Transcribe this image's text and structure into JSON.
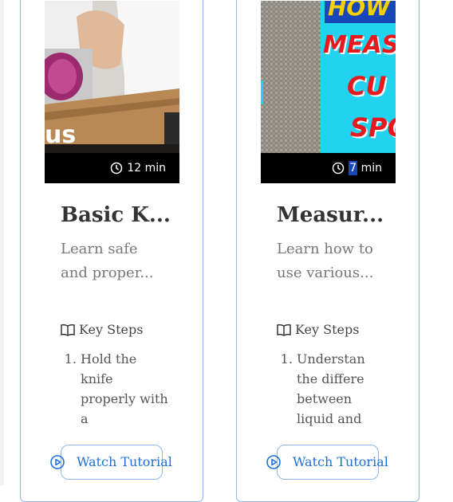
{
  "cards": [
    {
      "duration": "12 min",
      "thumb_overlay_text": "us",
      "title": "Basic K...",
      "description": "Learn safe and proper...",
      "key_steps_label": "Key Steps",
      "steps": [
        "Hold the knife properly with a"
      ],
      "watch_label": "Watch Tutorial"
    },
    {
      "duration_num": "7",
      "duration_unit": " min",
      "thumb_overlay_text": [
        "HOW",
        "MEAS",
        "CU",
        "SPO"
      ],
      "title": "Measur...",
      "description": "Learn how to use various...",
      "key_steps_label": "Key Steps",
      "steps": [
        "Understan the differe between liquid and"
      ],
      "watch_label": "Watch Tutorial"
    }
  ],
  "colors": {
    "card_border": "#8ab6e8",
    "link": "#1e6fd9",
    "title": "#333333",
    "body": "#777777",
    "thumb_cyan": "#22d3f0",
    "thumb_yellow_text": "#f5d000",
    "thumb_red_text": "#e8191e"
  },
  "icons": [
    "clock-icon",
    "book-open-icon",
    "play-circle-icon"
  ]
}
